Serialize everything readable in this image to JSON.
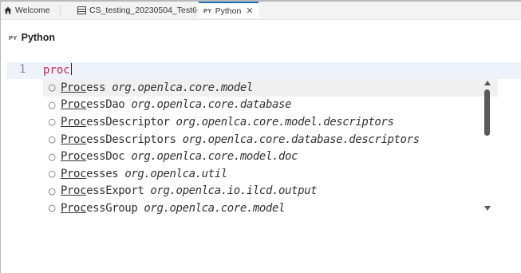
{
  "tabs": [
    {
      "label": "Welcome",
      "icon": "home-icon"
    },
    {
      "label": "CS_testing_20230504_Test6",
      "icon": "table-icon"
    },
    {
      "label": "Python",
      "icon": "python-badge-icon",
      "badge": "PY",
      "active": true
    }
  ],
  "editor": {
    "title": "Python",
    "title_badge": "PY",
    "line_number": "1",
    "code": "proc"
  },
  "completions": [
    {
      "match": "Proc",
      "rest": "ess",
      "pkg": "org.openlca.core.model"
    },
    {
      "match": "Proc",
      "rest": "essDao",
      "pkg": "org.openlca.core.database"
    },
    {
      "match": "Proc",
      "rest": "essDescriptor",
      "pkg": "org.openlca.core.model.descriptors"
    },
    {
      "match": "Proc",
      "rest": "essDescriptors",
      "pkg": "org.openlca.core.database.descriptors"
    },
    {
      "match": "Proc",
      "rest": "essDoc",
      "pkg": "org.openlca.core.model.doc"
    },
    {
      "match": "Proc",
      "rest": "esses",
      "pkg": "org.openlca.util"
    },
    {
      "match": "Proc",
      "rest": "essExport",
      "pkg": "org.openlca.io.ilcd.output"
    },
    {
      "match": "Proc",
      "rest": "essGroup",
      "pkg": "org.openlca.core.model"
    }
  ],
  "colors": {
    "accent": "#1f6fb8",
    "keyword": "#c7254e"
  }
}
